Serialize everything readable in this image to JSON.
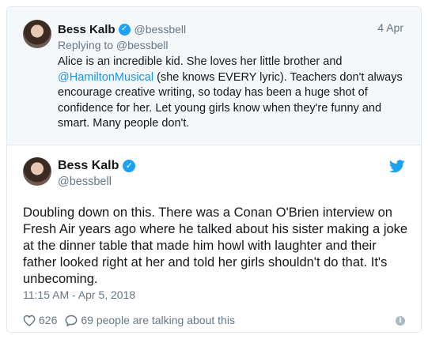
{
  "parent_tweet": {
    "author_name": "Bess Kalb",
    "author_handle": "@bessbell",
    "date": "4 Apr",
    "replying_to": "Replying to @bessbell",
    "text_before_link": "Alice is an incredible kid. She loves her little brother and ",
    "link": "@HamiltonMusical",
    "text_after_link": " (she knows EVERY lyric). Teachers don't always encourage creative writing, so today has been a huge shot of confidence for her. Let young girls know when they're funny and smart. Many people don't."
  },
  "main_tweet": {
    "author_name": "Bess Kalb",
    "author_handle": "@bessbell",
    "text": "Doubling down on this. There was a Conan O'Brien interview on Fresh Air years ago where he talked about his sister making a joke at the dinner table that made him howl with laughter and their father looked right at her and told her girls shouldn't do that. It's unbecoming.",
    "timestamp": "11:15 AM - Apr 5, 2018",
    "like_count": "626",
    "talking_text": "69 people are talking about this"
  },
  "icons": {
    "verified": "verified-badge-icon",
    "bird": "twitter-bird-icon",
    "heart": "heart-icon",
    "reply": "reply-bubble-icon",
    "info": "info-icon"
  },
  "colors": {
    "accent": "#1da1f2",
    "link": "#1b95e0",
    "muted": "#657786",
    "text": "#14171a",
    "parent_bg": "#f5f8fa"
  }
}
